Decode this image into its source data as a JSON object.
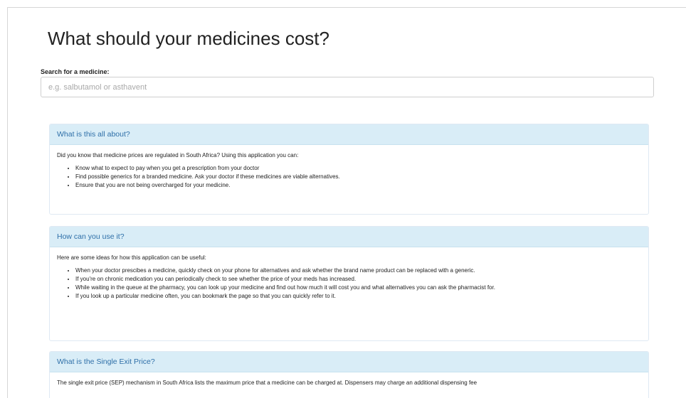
{
  "page": {
    "title": "What should your medicines cost?"
  },
  "search": {
    "label": "Search for a medicine:",
    "placeholder": "e.g. salbutamol or asthavent"
  },
  "panels": [
    {
      "heading": "What is this all about?",
      "intro": "Did you know that medicine prices are regulated in South Africa? Using this application you can:",
      "items": [
        "Know what to expect to pay when you get a prescription from your doctor",
        "Find possible generics for a branded medicine. Ask your doctor if these medicines are viable alternatives.",
        "Ensure that you are not being overcharged for your medicine."
      ]
    },
    {
      "heading": "How can you use it?",
      "intro": "Here are some ideas for how this application can be useful:",
      "items": [
        "When your doctor prescibes a medicine, quickly check on your phone for alternatives and ask whether the brand name product can be replaced with a generic.",
        "If you're on chronic medication you can periodically check to see whether the price of your meds has increased.",
        "While waiting in the queue at the pharmacy, you can look up your medicine and find out how much it will cost you and what alternatives you can ask the pharmacist for.",
        "If you look up a particular medicine often, you can bookmark the page so that you can quickly refer to it."
      ]
    },
    {
      "heading": "What is the Single Exit Price?",
      "intro": "The single exit price (SEP) mechanism in South Africa lists the maximum price that a medicine can be charged at. Dispensers may charge an additional dispensing fee"
    }
  ]
}
